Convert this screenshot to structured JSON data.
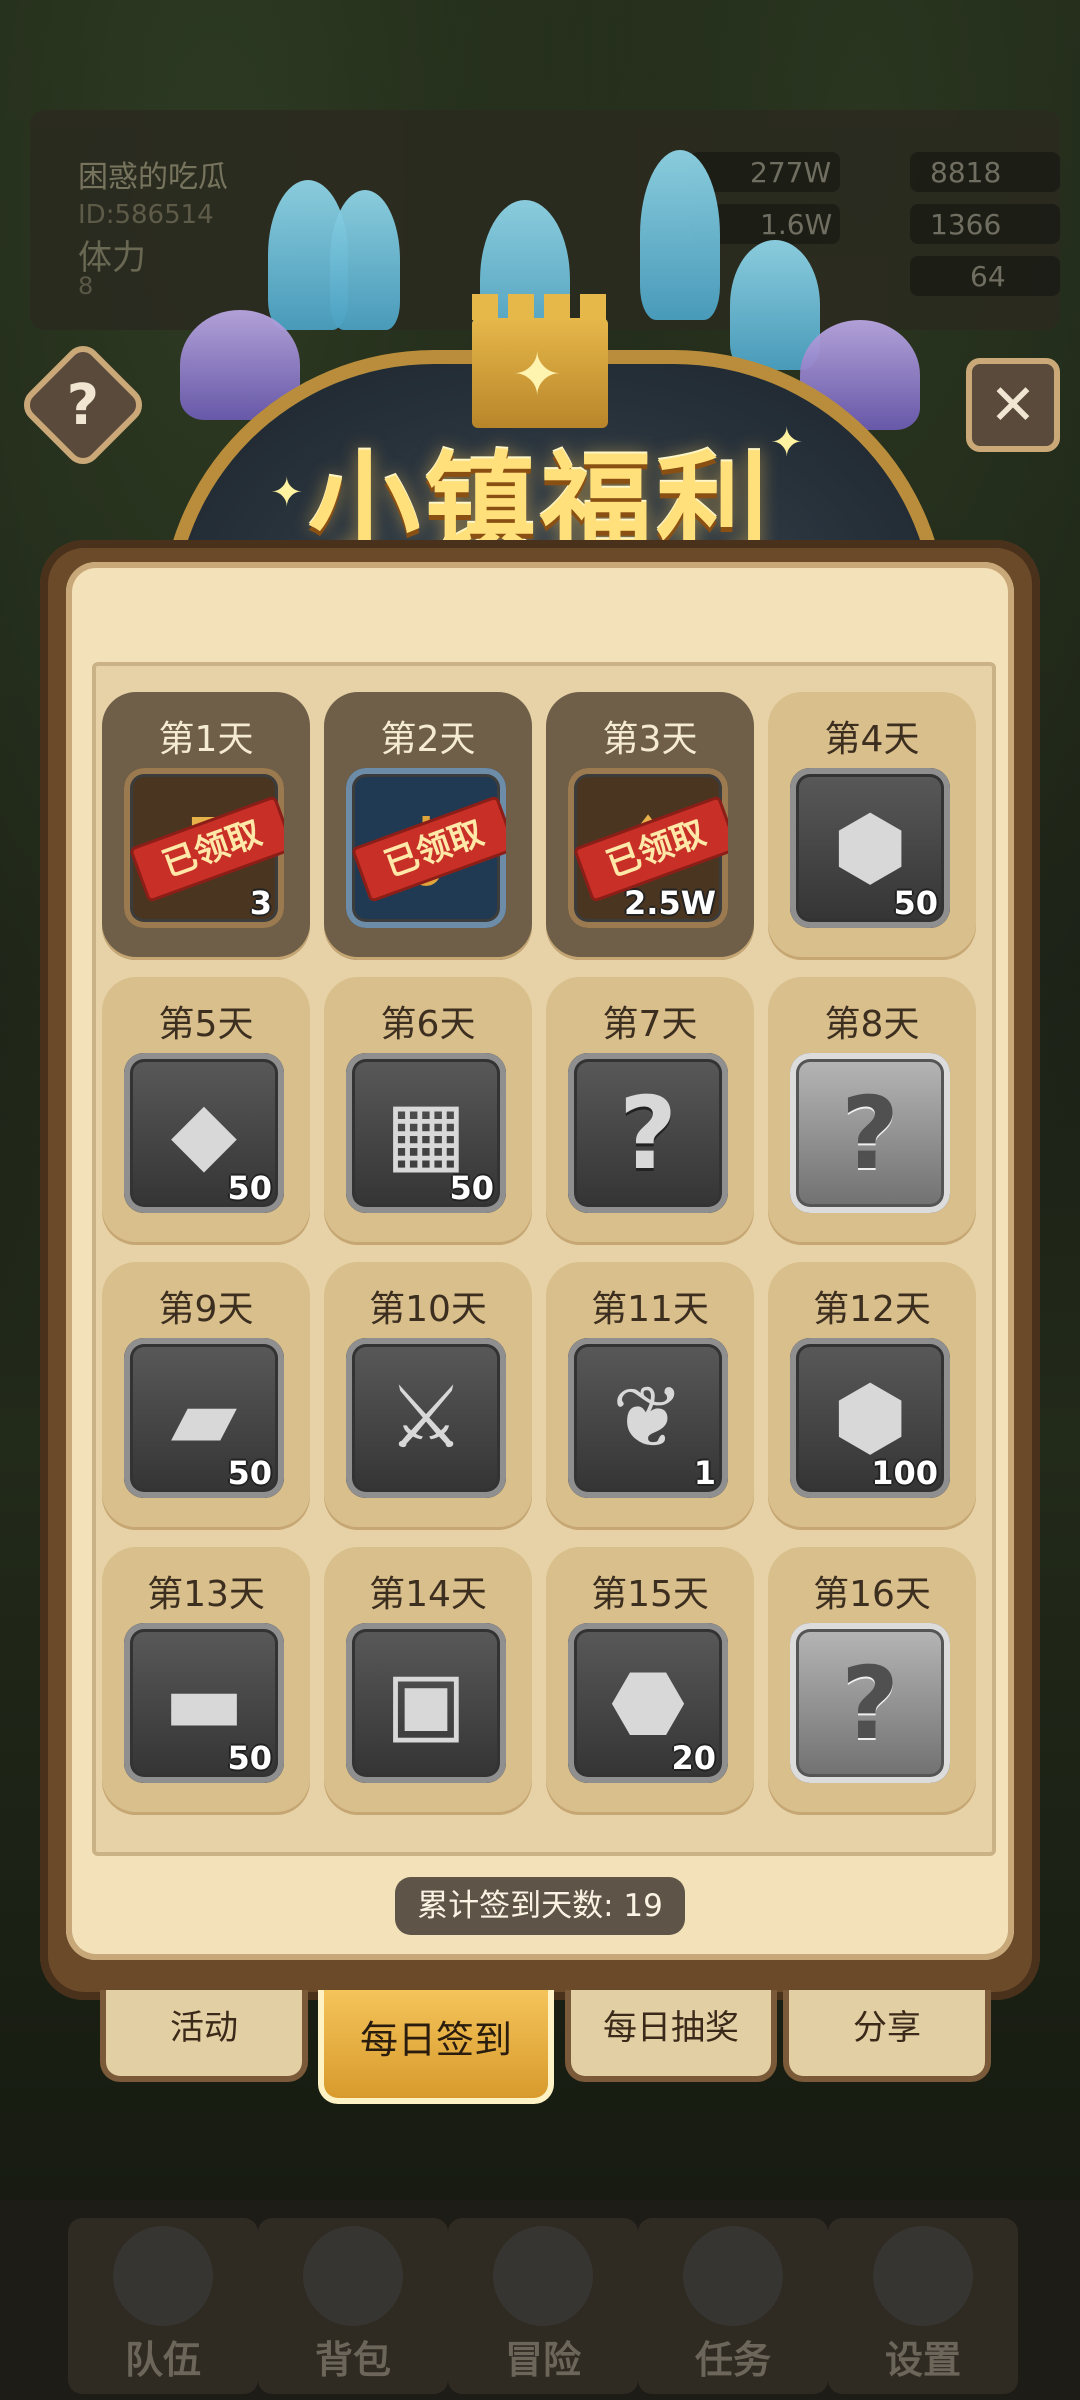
{
  "player": {
    "name": "困惑的吃瓜",
    "id": "ID:586514",
    "stamina_label": "体力",
    "stamina_value": "8"
  },
  "resources": [
    {
      "name": "gold",
      "value": "277W"
    },
    {
      "name": "stone-bar",
      "value": "8818"
    },
    {
      "name": "gem",
      "value": "1.6W"
    },
    {
      "name": "ore",
      "value": "1366"
    },
    {
      "name": "crystal",
      "value": "64"
    }
  ],
  "banner": {
    "title": "小镇福利"
  },
  "days": [
    {
      "label": "第1天",
      "claimed": true,
      "stamp": "已领取",
      "qty": "3",
      "icon": "potion-icon",
      "slot": "orange"
    },
    {
      "label": "第2天",
      "claimed": true,
      "stamp": "已领取",
      "qty": "",
      "icon": "key-icon",
      "slot": "blue"
    },
    {
      "label": "第3天",
      "claimed": true,
      "stamp": "已领取",
      "qty": "2.5W",
      "icon": "gold-bag-icon",
      "slot": "orange"
    },
    {
      "label": "第4天",
      "claimed": false,
      "stamp": "",
      "qty": "50",
      "icon": "crystal-ore-icon",
      "slot": "dark"
    },
    {
      "label": "第5天",
      "claimed": false,
      "stamp": "",
      "qty": "50",
      "icon": "rock-icon",
      "slot": "dark"
    },
    {
      "label": "第6天",
      "claimed": false,
      "stamp": "",
      "qty": "50",
      "icon": "leather-icon",
      "slot": "dark"
    },
    {
      "label": "第7天",
      "claimed": false,
      "stamp": "",
      "qty": "",
      "icon": "question-icon",
      "slot": "dark"
    },
    {
      "label": "第8天",
      "claimed": false,
      "stamp": "",
      "qty": "",
      "icon": "question-icon",
      "slot": "light"
    },
    {
      "label": "第9天",
      "claimed": false,
      "stamp": "",
      "qty": "50",
      "icon": "metal-bar-icon",
      "slot": "dark"
    },
    {
      "label": "第10天",
      "claimed": false,
      "stamp": "",
      "qty": "",
      "icon": "sword-icon",
      "slot": "dark"
    },
    {
      "label": "第11天",
      "claimed": false,
      "stamp": "",
      "qty": "1",
      "icon": "feather-icon",
      "slot": "dark"
    },
    {
      "label": "第12天",
      "claimed": false,
      "stamp": "",
      "qty": "100",
      "icon": "crystal-ore-icon",
      "slot": "dark"
    },
    {
      "label": "第13天",
      "claimed": false,
      "stamp": "",
      "qty": "50",
      "icon": "wood-log-icon",
      "slot": "dark"
    },
    {
      "label": "第14天",
      "claimed": false,
      "stamp": "",
      "qty": "",
      "icon": "backpack-icon",
      "slot": "dark"
    },
    {
      "label": "第15天",
      "claimed": false,
      "stamp": "",
      "qty": "20",
      "icon": "rune-stone-icon",
      "slot": "dark"
    },
    {
      "label": "第16天",
      "claimed": false,
      "stamp": "",
      "qty": "",
      "icon": "question-icon",
      "slot": "light"
    }
  ],
  "total_days": "累计签到天数: 19",
  "tabs": [
    {
      "label": "活动",
      "active": false
    },
    {
      "label": "每日签到",
      "active": true
    },
    {
      "label": "每日抽奖",
      "active": false
    },
    {
      "label": "分享",
      "active": false
    }
  ],
  "bottom_nav": [
    {
      "label": "队伍",
      "icon": "helmet-icon"
    },
    {
      "label": "背包",
      "icon": "backpack-icon"
    },
    {
      "label": "冒险",
      "icon": "crossed-swords-icon"
    },
    {
      "label": "任务",
      "icon": "scroll-icon"
    },
    {
      "label": "设置",
      "icon": "gear-icon"
    }
  ]
}
